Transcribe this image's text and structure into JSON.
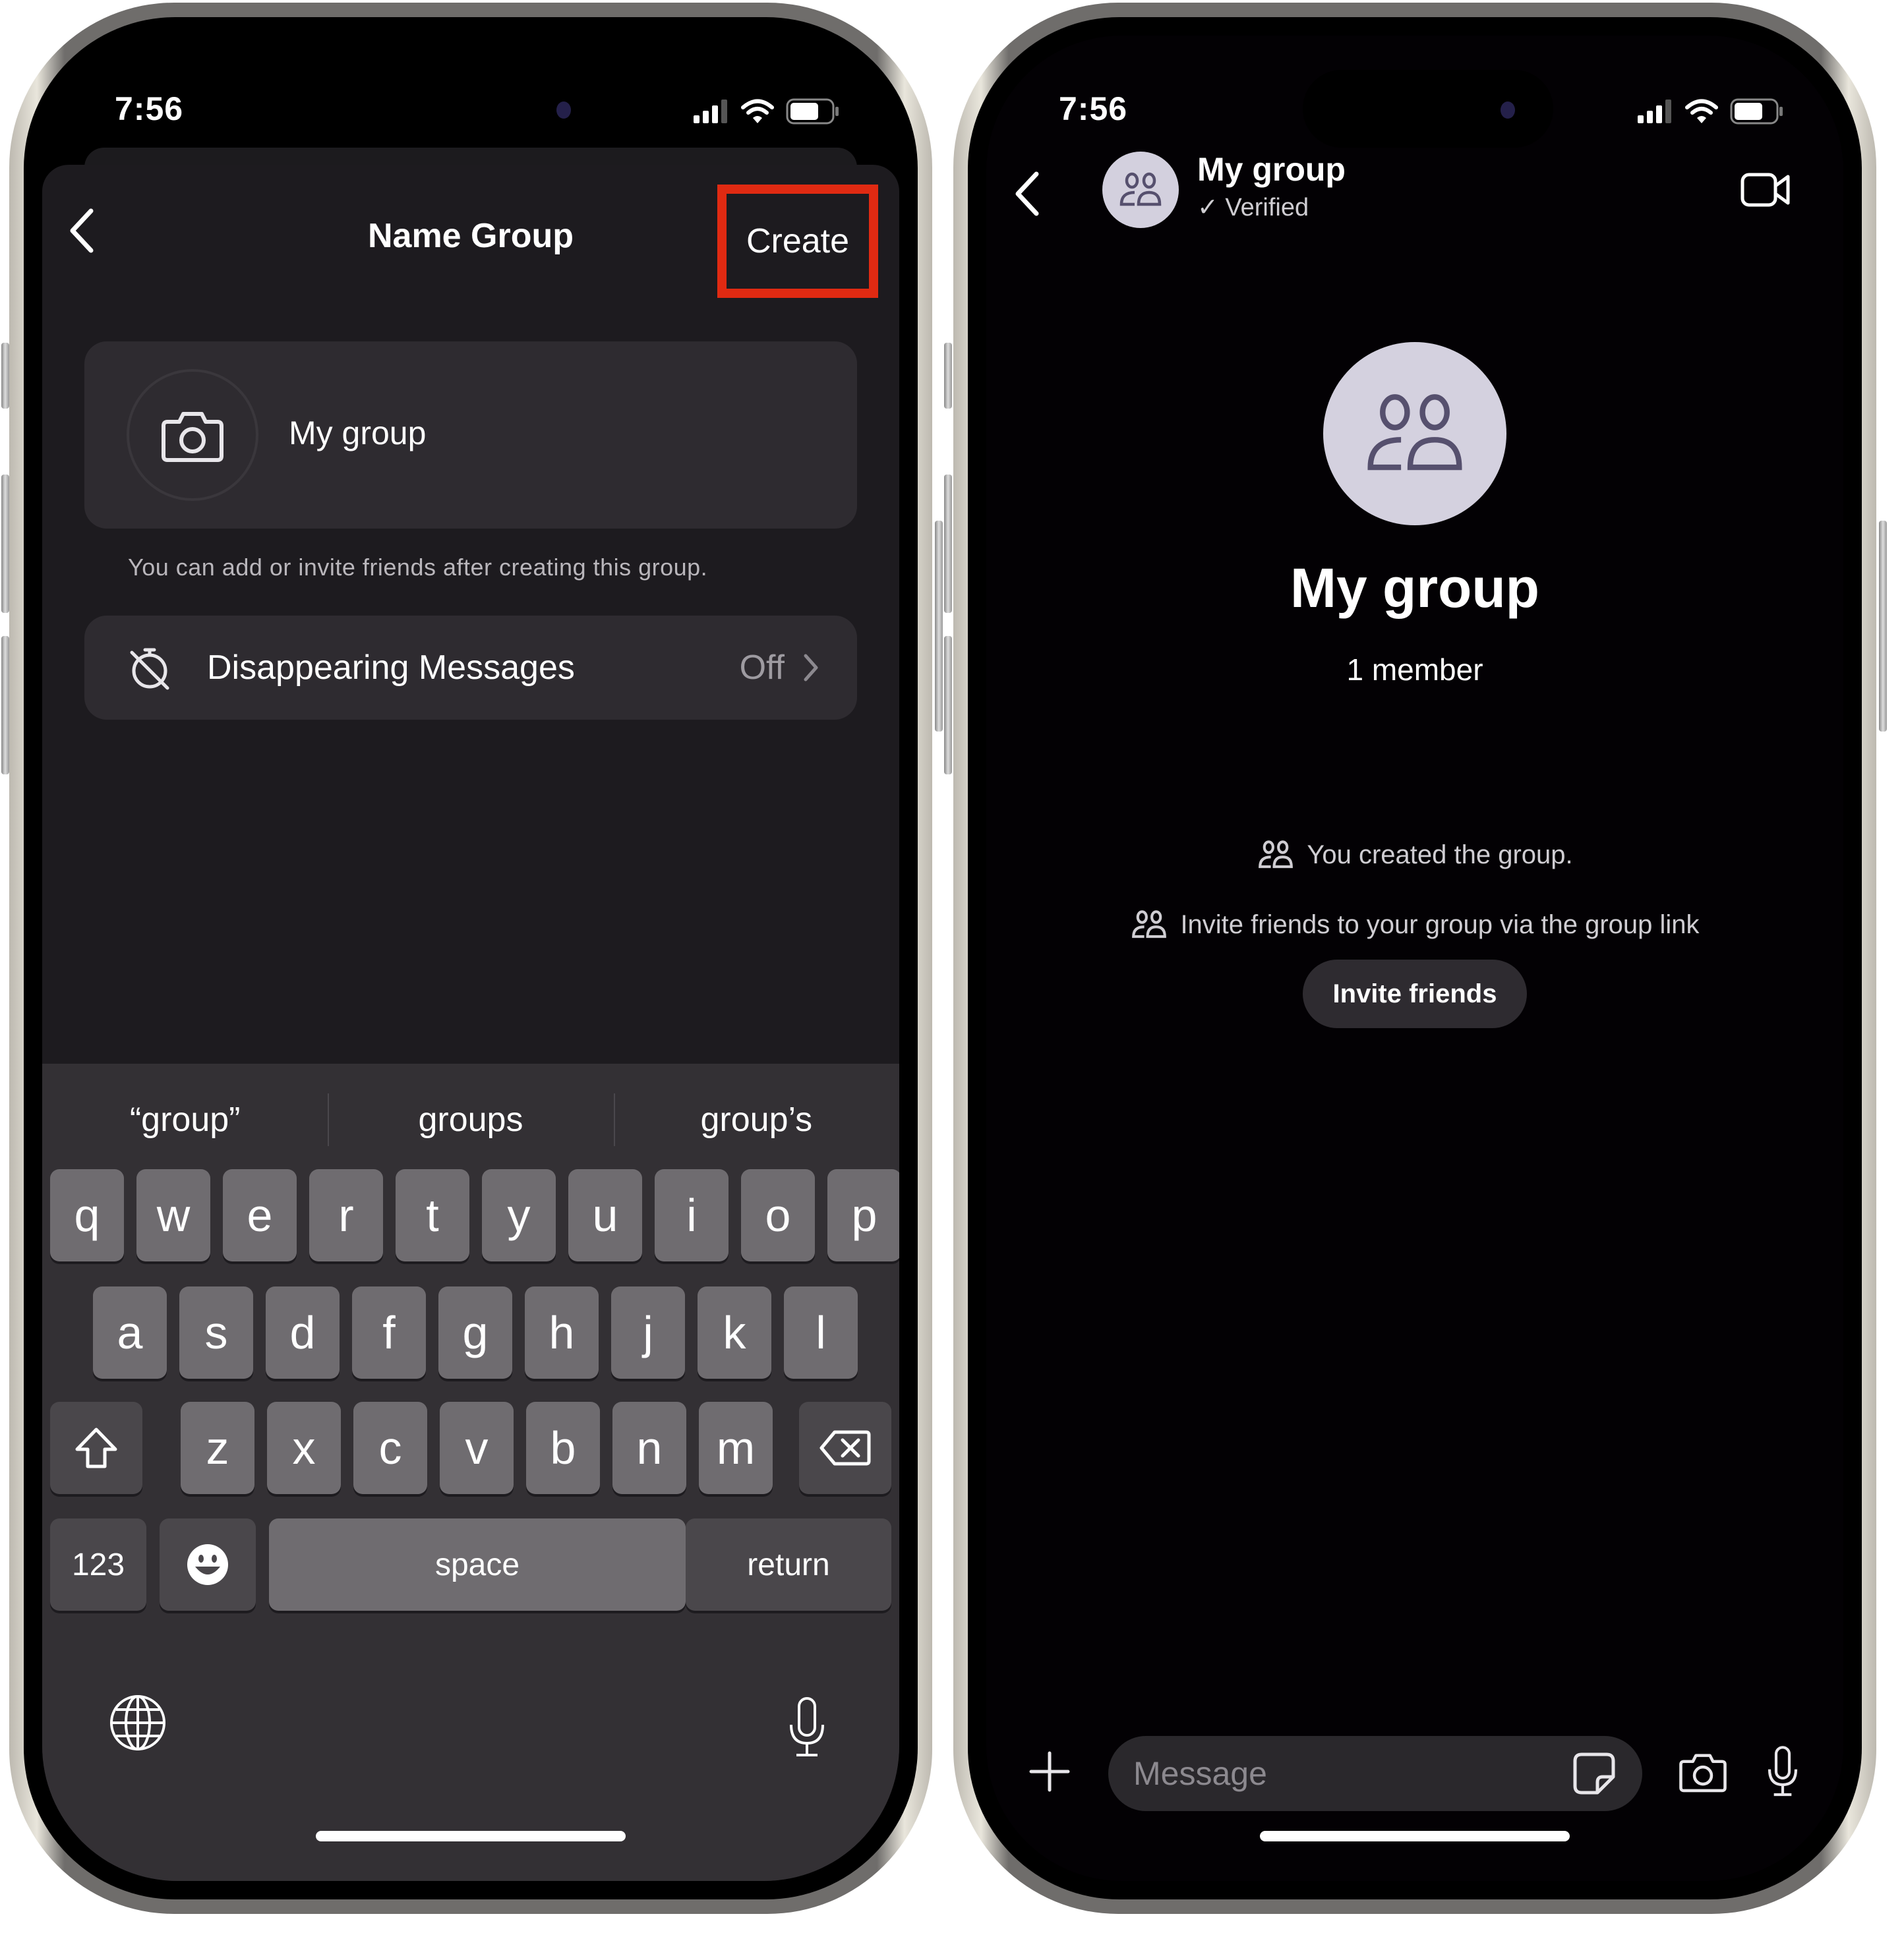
{
  "left_phone": {
    "status_bar": {
      "time": "7:56",
      "icons": [
        "cellular-signal-icon",
        "wifi-icon",
        "battery-icon"
      ]
    },
    "nav": {
      "back_icon": "chevron-left-icon",
      "title": "Name Group",
      "create_label": "Create",
      "highlight_color": "#e02a12"
    },
    "group_name_card": {
      "camera_icon": "camera-icon",
      "name_value": "My group"
    },
    "hint": "You can add or invite friends after creating this group.",
    "disappearing_messages": {
      "icon": "timer-off-icon",
      "label": "Disappearing Messages",
      "value": "Off",
      "chevron": "chevron-right-icon"
    },
    "keyboard": {
      "suggestions": [
        "“group”",
        "groups",
        "group’s"
      ],
      "row1": [
        "q",
        "w",
        "e",
        "r",
        "t",
        "y",
        "u",
        "i",
        "o",
        "p"
      ],
      "row2": [
        "a",
        "s",
        "d",
        "f",
        "g",
        "h",
        "j",
        "k",
        "l"
      ],
      "row3": [
        "z",
        "x",
        "c",
        "v",
        "b",
        "n",
        "m"
      ],
      "numbers_label": "123",
      "space_label": "space",
      "return_label": "return",
      "shift_icon": "shift-icon",
      "delete_icon": "backspace-icon",
      "emoji_icon": "emoji-icon",
      "globe_icon": "globe-icon",
      "dictation_icon": "microphone-icon"
    }
  },
  "right_phone": {
    "status_bar": {
      "time": "7:56",
      "icons": [
        "cellular-signal-icon",
        "wifi-icon",
        "battery-icon"
      ]
    },
    "header": {
      "back_icon": "chevron-left-icon",
      "group_name": "My group",
      "verified": "✓ Verified",
      "video_icon": "video-call-icon"
    },
    "profile": {
      "group_name": "My group",
      "members": "1 member"
    },
    "events": [
      {
        "icon": "group-icon",
        "text": "You created the group."
      },
      {
        "icon": "group-icon",
        "text": "Invite friends to your group via the group link"
      }
    ],
    "invite_button": "Invite friends",
    "composer": {
      "add_icon": "plus-icon",
      "placeholder": "Message",
      "sticker_icon": "sticker-icon",
      "camera_icon": "camera-icon",
      "mic_icon": "microphone-icon"
    }
  }
}
